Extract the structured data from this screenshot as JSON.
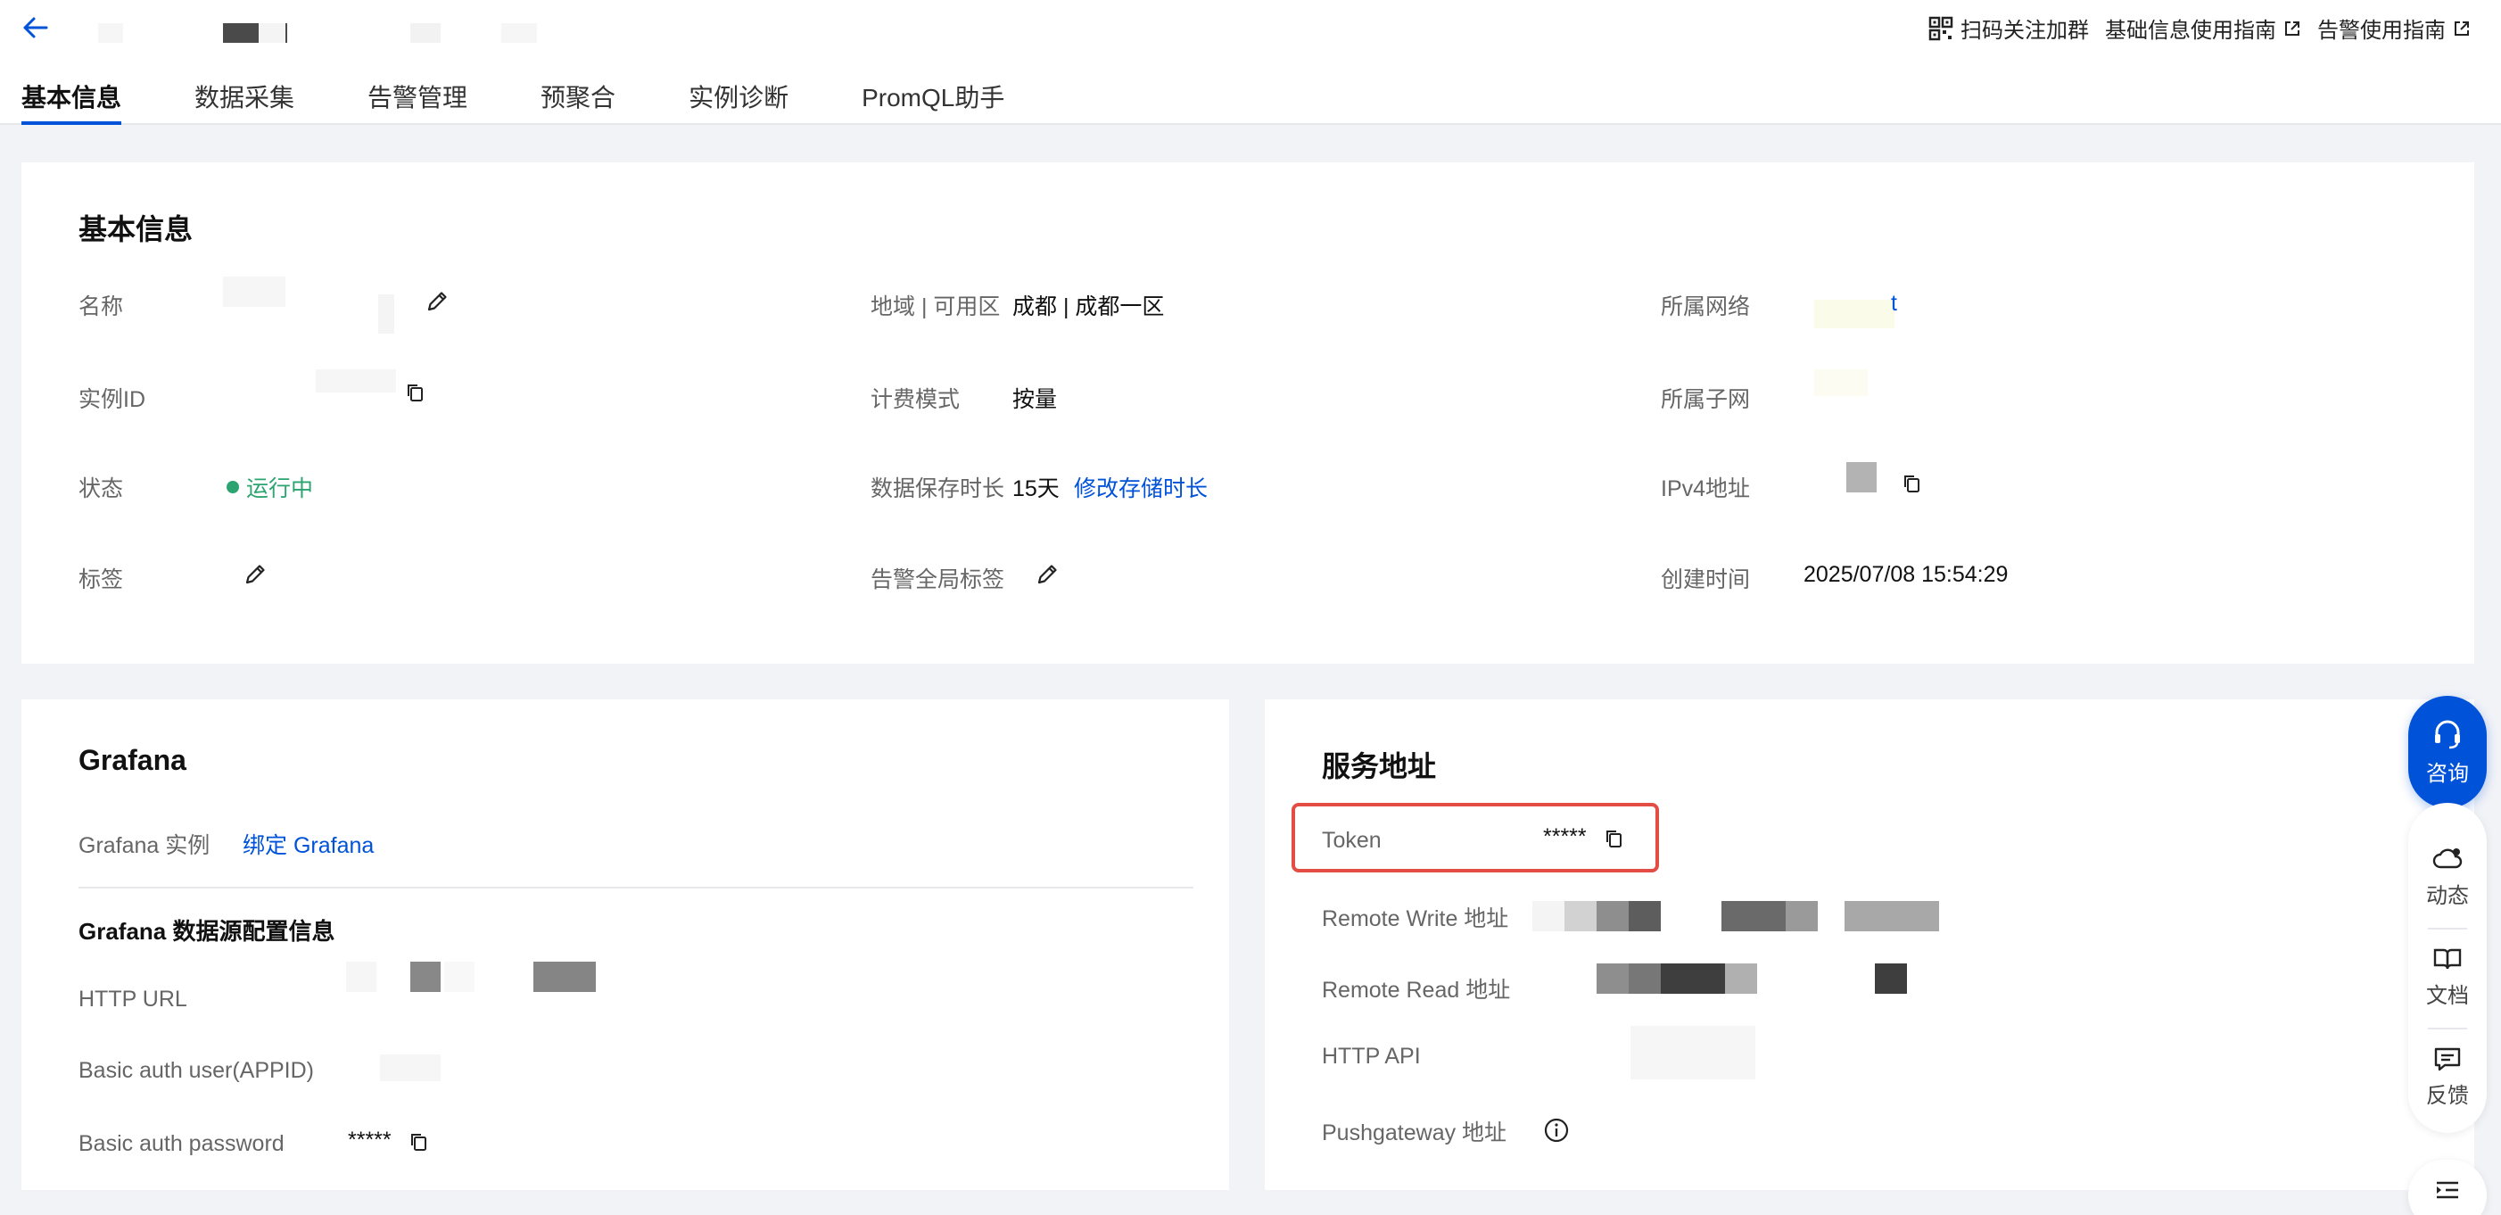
{
  "topbar": {
    "qr_label": "扫码关注加群",
    "guide_basic": "基础信息使用指南",
    "guide_alarm": "告警使用指南"
  },
  "tabs": [
    {
      "label": "基本信息",
      "active": true
    },
    {
      "label": "数据采集",
      "active": false
    },
    {
      "label": "告警管理",
      "active": false
    },
    {
      "label": "预聚合",
      "active": false
    },
    {
      "label": "实例诊断",
      "active": false
    },
    {
      "label": "PromQL助手",
      "active": false
    }
  ],
  "basic": {
    "title": "基本信息",
    "name_label": "名称",
    "id_label": "实例ID",
    "status_label": "状态",
    "status_value": "运行中",
    "tags_label": "标签",
    "region_label": "地域 | 可用区",
    "region_value": "成都 | 成都一区",
    "billing_label": "计费模式",
    "billing_value": "按量",
    "retention_label": "数据保存时长",
    "retention_value": "15天",
    "retention_link": "修改存储时长",
    "alarm_tags_label": "告警全局标签",
    "vpc_label": "所属网络",
    "vpc_value_fragment": "t",
    "subnet_label": "所属子网",
    "ipv4_label": "IPv4地址",
    "created_label": "创建时间",
    "created_value": "2025/07/08 15:54:29"
  },
  "grafana": {
    "title": "Grafana",
    "instance_label": "Grafana 实例",
    "bind_link": "绑定 Grafana",
    "ds_title": "Grafana 数据源配置信息",
    "http_url_label": "HTTP URL",
    "basic_user_label": "Basic auth user(APPID)",
    "basic_password_label": "Basic auth password",
    "basic_password_value": "*****"
  },
  "service": {
    "title": "服务地址",
    "token_label": "Token",
    "token_value": "*****",
    "remote_write_label": "Remote Write 地址",
    "remote_read_label": "Remote Read 地址",
    "http_api_label": "HTTP API",
    "pushgateway_label": "Pushgateway 地址"
  },
  "side": {
    "consult": "咨询",
    "news": "动态",
    "docs": "文档",
    "feedback": "反馈"
  },
  "colors": {
    "primary": "#0052d9",
    "success": "#2ba471",
    "highlight": "#e34d44",
    "background": "#f1f3f7"
  }
}
